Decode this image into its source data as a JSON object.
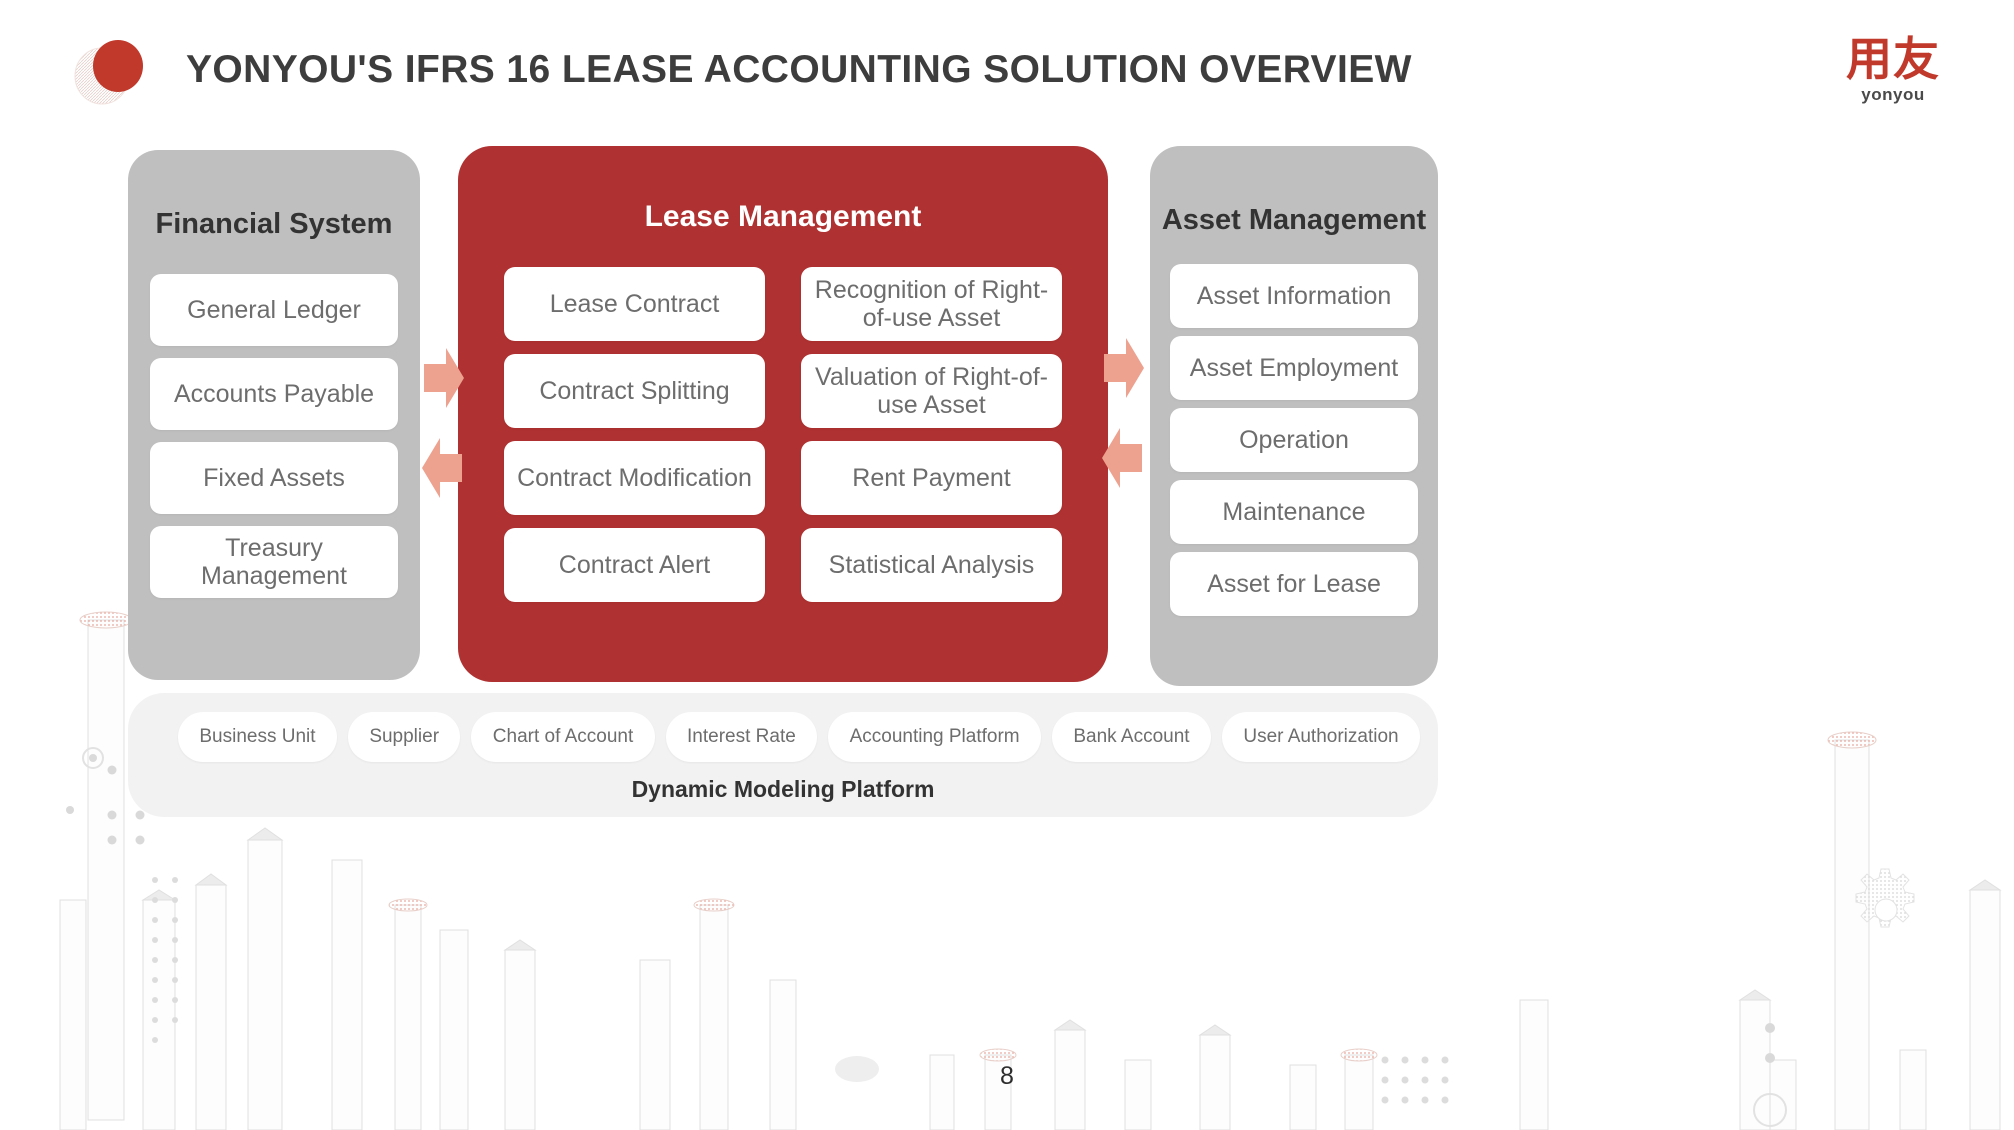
{
  "header": {
    "title": "YONYOU'S IFRS 16 LEASE ACCOUNTING SOLUTION OVERVIEW",
    "logo_cn": "用友",
    "logo_en": "yonyou",
    "brand_red": "#c0392b",
    "title_color": "#3d3d3d"
  },
  "panels": {
    "financial": {
      "title": "Financial System",
      "bg_color": "#bfbfbf",
      "items": [
        "General Ledger",
        "Accounts Payable",
        "Fixed Assets",
        "Treasury Management"
      ]
    },
    "lease": {
      "title": "Lease Management",
      "bg_color": "#af3131",
      "items": [
        "Lease Contract",
        "Recognition of Right-of-use Asset",
        "Contract Splitting",
        "Valuation of Right-of-use Asset",
        "Contract Modification",
        "Rent Payment",
        "Contract Alert",
        "Statistical Analysis"
      ]
    },
    "asset": {
      "title": "Asset Management",
      "bg_color": "#bfbfbf",
      "items": [
        "Asset Information",
        "Asset Employment",
        "Operation",
        "Maintenance",
        "Asset for Lease"
      ]
    }
  },
  "arrows": {
    "color": "#eda18f",
    "left_pair": [
      "arrow-right-icon",
      "arrow-left-icon"
    ],
    "right_pair": [
      "arrow-right-icon",
      "arrow-left-icon"
    ]
  },
  "platform": {
    "label": "Dynamic Modeling Platform",
    "bg_color": "#f2f2f2",
    "chips": [
      "Business Unit",
      "Supplier",
      "Chart of Account",
      "Interest Rate",
      "Accounting Platform",
      "Bank Account",
      "User Authorization"
    ]
  },
  "footer": {
    "page_number": "8"
  },
  "decorations": {
    "gear_icon": "gear-icon",
    "skyline": "building-skyline"
  }
}
